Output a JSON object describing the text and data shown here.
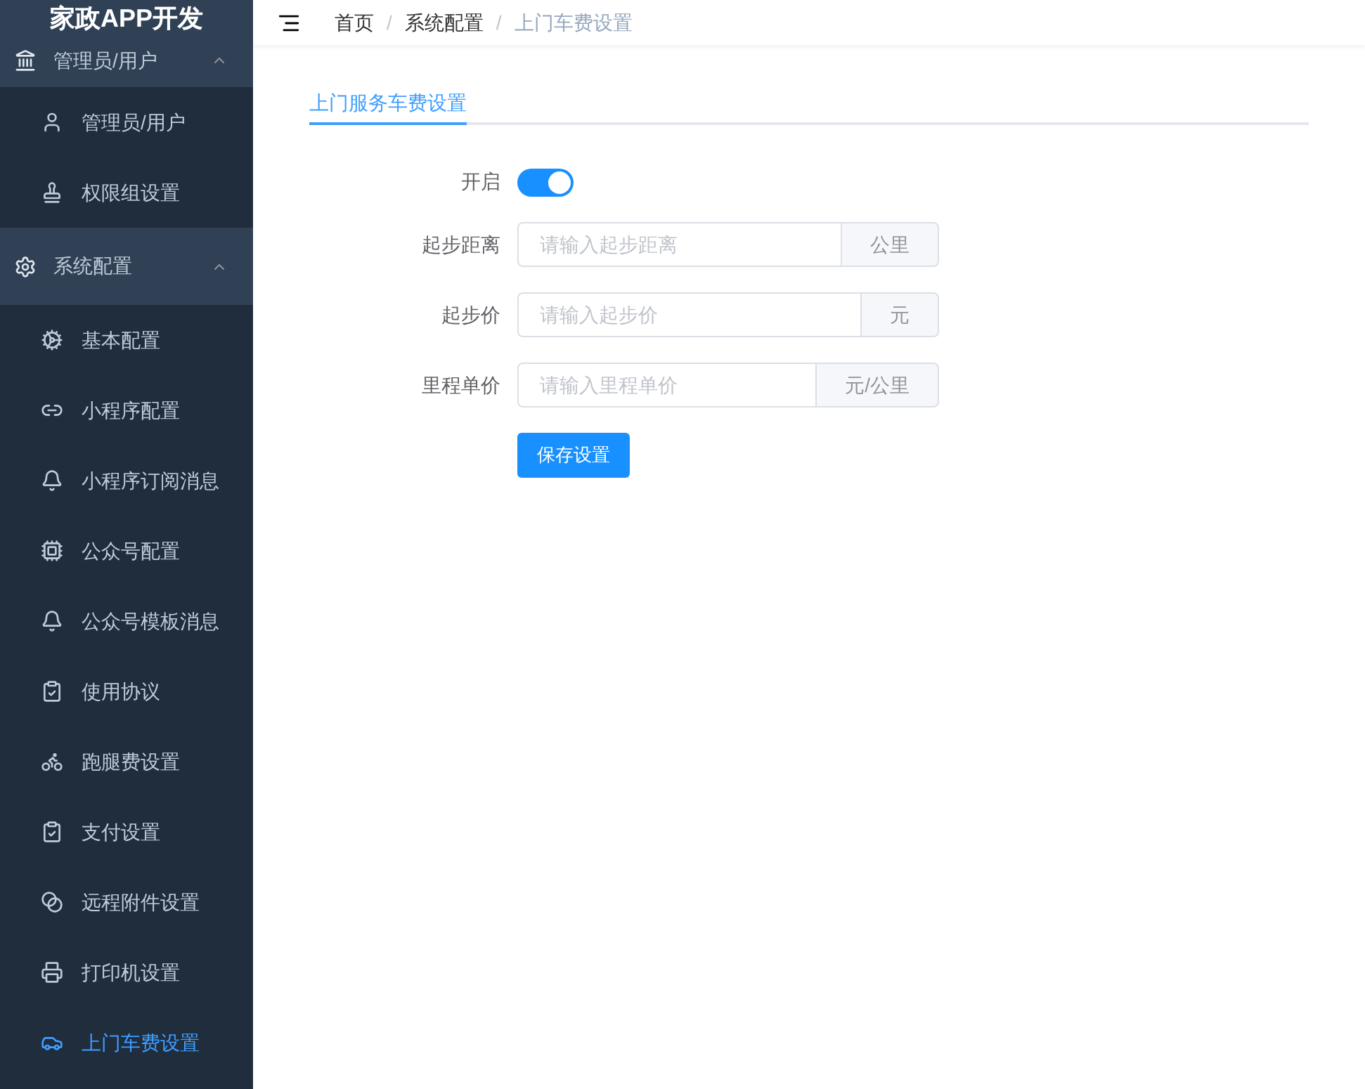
{
  "sidebar": {
    "logo": "家政APP开发",
    "groups": [
      {
        "label": "管理员/用户",
        "expanded": true,
        "items": [
          {
            "label": "管理员/用户",
            "selected": false
          },
          {
            "label": "权限组设置",
            "selected": false
          }
        ]
      },
      {
        "label": "系统配置",
        "expanded": true,
        "items": [
          {
            "label": "基本配置",
            "selected": false
          },
          {
            "label": "小程序配置",
            "selected": false
          },
          {
            "label": "小程序订阅消息",
            "selected": false
          },
          {
            "label": "公众号配置",
            "selected": false
          },
          {
            "label": "公众号模板消息",
            "selected": false
          },
          {
            "label": "使用协议",
            "selected": false
          },
          {
            "label": "跑腿费设置",
            "selected": false
          },
          {
            "label": "支付设置",
            "selected": false
          },
          {
            "label": "远程附件设置",
            "selected": false
          },
          {
            "label": "打印机设置",
            "selected": false
          },
          {
            "label": "上门车费设置",
            "selected": true
          }
        ]
      }
    ]
  },
  "breadcrumb": {
    "separator": "/",
    "items": [
      "首页",
      "系统配置",
      "上门车费设置"
    ]
  },
  "tabs": [
    {
      "label": "上门服务车费设置",
      "selected": true
    }
  ],
  "form": {
    "fields": [
      {
        "kind": "switch",
        "label": "开启",
        "on": true
      },
      {
        "kind": "input",
        "label": "起步距离",
        "placeholder": "请输入起步距离",
        "unit": "公里"
      },
      {
        "kind": "input",
        "label": "起步价",
        "placeholder": "请输入起步价",
        "unit": "元"
      },
      {
        "kind": "input",
        "label": "里程单价",
        "placeholder": "请输入里程单价",
        "unit": "元/公里"
      }
    ],
    "submit": "保存设置"
  }
}
